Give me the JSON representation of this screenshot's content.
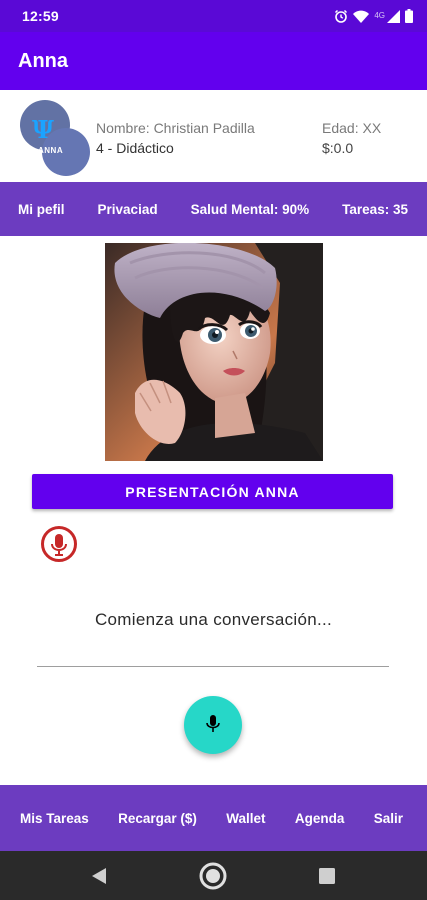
{
  "status_bar": {
    "time": "12:59",
    "network": "4G",
    "icons": [
      "alarm-icon",
      "wifi-icon",
      "signal-icon",
      "battery-icon"
    ]
  },
  "app_bar": {
    "title": "Anna"
  },
  "profile": {
    "logo_text": "ANNA",
    "name": "Nombre: Christian Padilla",
    "level": "4 - Didáctico",
    "age": "Edad: XX",
    "balance": "$:0.0"
  },
  "top_nav": {
    "items": [
      "Mi pefil",
      "Privaciad",
      "Salud Mental: 90%",
      "Tareas: 35"
    ]
  },
  "main": {
    "avatar_image": "anime-girl-portrait-with-beanie",
    "presentation_button": "PRESENTACIÓN ANNA",
    "conversation_prompt": "Comienza una conversación...",
    "mic_fab_icon": "microphone-icon",
    "recording_indicator_icon": "microphone-recording-icon"
  },
  "bottom_nav": {
    "items": [
      "Mis Tareas",
      "Recargar ($)",
      "Wallet",
      "Agenda",
      "Salir"
    ]
  },
  "system_nav": {
    "icons": [
      "back-icon",
      "home-icon",
      "recents-icon"
    ]
  },
  "colors": {
    "status_bar": "#5a09d6",
    "app_bar": "#6200ee",
    "nav_bar": "#6c3cc0",
    "fab": "#26d7c8",
    "recording_red": "#c62828"
  }
}
